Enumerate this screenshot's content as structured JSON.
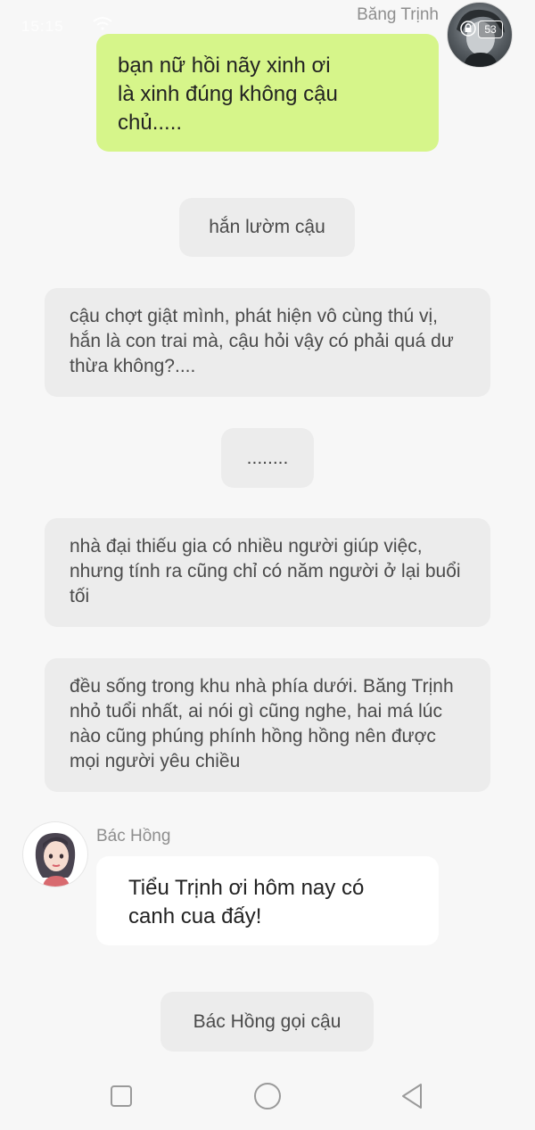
{
  "status_bar": {
    "time": "15:15"
  },
  "sender_right": {
    "name": "Băng Trịnh",
    "badge": "53"
  },
  "message_right": {
    "lines": [
      "bạn nữ hồi nãy xinh ơi",
      "là xinh đúng không cậu",
      "chủ....."
    ]
  },
  "narration": [
    {
      "text": "hắn lườm cậu"
    },
    {
      "text": "cậu chợt giật mình, phát hiện vô cùng thú vị, hắn là con trai mà, cậu hỏi vậy có phải quá dư thừa không?...."
    },
    {
      "text": "........"
    },
    {
      "text": "nhà đại thiếu gia có nhiều người giúp việc, nhưng tính ra cũng chỉ có năm người ở lại buổi tối"
    },
    {
      "text": "đều sống trong khu nhà phía dưới. Băng Trịnh nhỏ tuổi nhất, ai nói gì cũng nghe, hai má lúc nào cũng phúng phính hồng hồng nên được mọi người yêu chiều"
    },
    {
      "text": "Bác Hồng gọi cậu"
    }
  ],
  "sender_left": {
    "name": "Bác Hồng"
  },
  "message_left": {
    "lines": [
      "Tiểu Trịnh ơi hôm nay có",
      "canh cua đấy!"
    ]
  },
  "nav": {
    "recents_icon": "square-icon",
    "home_icon": "circle-icon",
    "back_icon": "triangle-back-icon"
  }
}
